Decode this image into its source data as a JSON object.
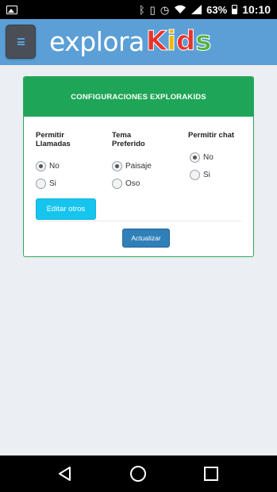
{
  "status_bar": {
    "battery_percent": "63%",
    "time": "10:10",
    "icons": [
      "gallery-icon",
      "bluetooth-icon",
      "vibrate-icon",
      "alarm-icon",
      "wifi-icon",
      "signal-icon",
      "battery-icon"
    ]
  },
  "app_bar": {
    "logo_explora": "explora",
    "logo_kids": [
      "K",
      "i",
      "d",
      "s"
    ],
    "logo_colors": [
      "#e8332a",
      "#f7b500",
      "#e8332a",
      "#55b33a"
    ]
  },
  "card": {
    "title": "CONFIGURACIONES EXPLORAKIDS",
    "columns": [
      {
        "label_line1": "Permitir",
        "label_line2": "Llamadas",
        "options": [
          "No",
          "Si"
        ],
        "selected": "No"
      },
      {
        "label_line1": "Tema",
        "label_line2": "Preferido",
        "options": [
          "Paisaje",
          "Oso"
        ],
        "selected": "Paisaje"
      },
      {
        "label_line1": "Permitir chat",
        "label_line2": "",
        "options": [
          "No",
          "Si"
        ],
        "selected": "No"
      }
    ],
    "edit_button": "Editar otros",
    "update_button": "Actualizar"
  },
  "colors": {
    "header_green": "#1fa558",
    "app_bar_blue": "#5b9fd6",
    "edit_button": "#16c5ee",
    "update_button": "#2f7fb8"
  }
}
